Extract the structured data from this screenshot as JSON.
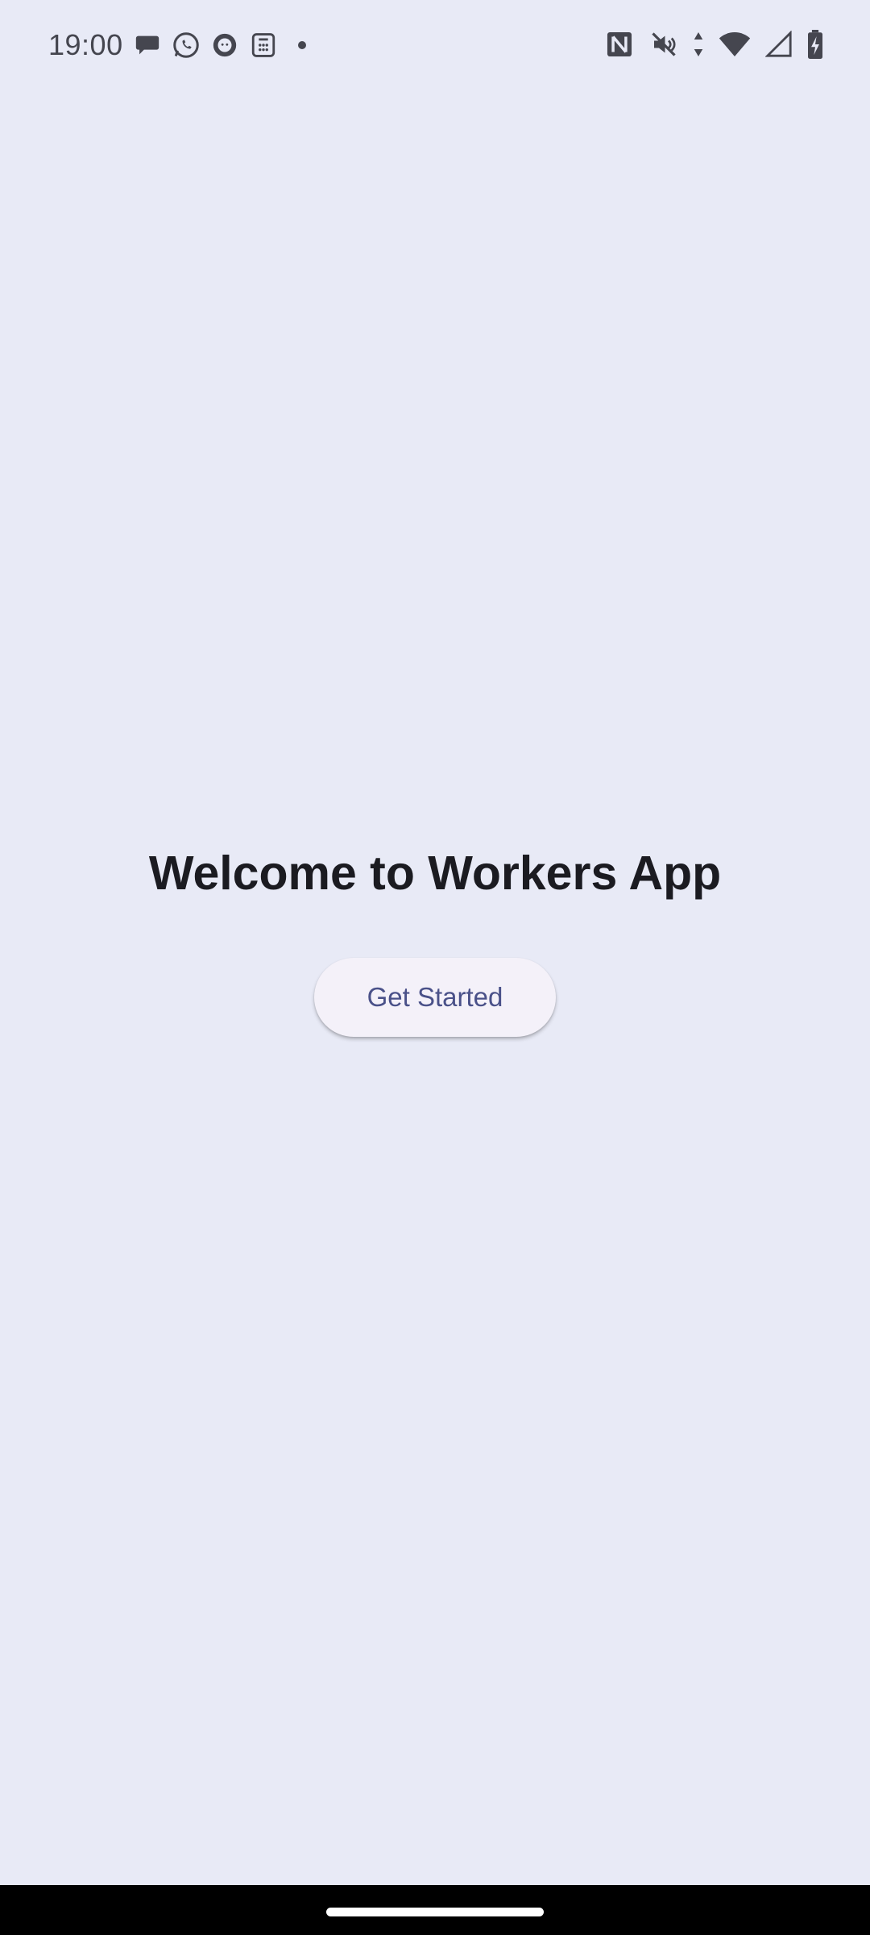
{
  "status_bar": {
    "time": "19:00",
    "notification_icons": [
      "chat-bubble-icon",
      "whatsapp-icon",
      "github-icon",
      "calculator-icon"
    ],
    "system_icons": [
      "nfc-icon",
      "mute-icon",
      "data-arrows-icon",
      "wifi-icon",
      "cellular-signal-icon",
      "battery-charging-icon"
    ]
  },
  "main": {
    "title": "Welcome to Workers App",
    "button_label": "Get Started"
  },
  "colors": {
    "background": "#E8EAF6",
    "button_background": "#F4F1F9",
    "button_text": "#4A5189",
    "title_text": "#1B1B21",
    "nav_bar": "#000000"
  }
}
